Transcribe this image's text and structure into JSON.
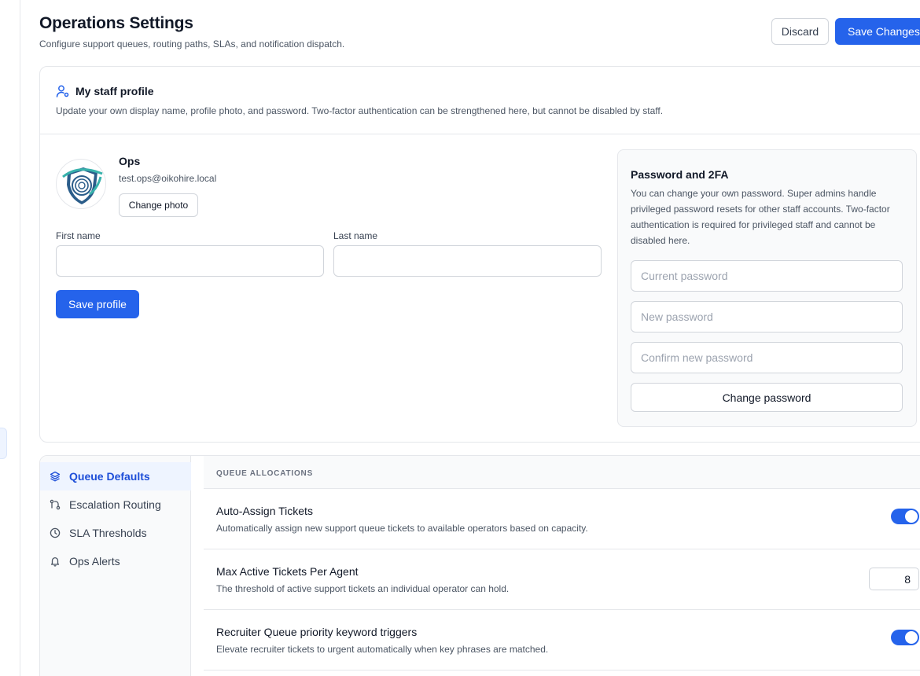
{
  "header": {
    "title": "Operations Settings",
    "subtitle": "Configure support queues, routing paths, SLAs, and notification dispatch.",
    "discard_label": "Discard",
    "save_label": "Save Changes"
  },
  "profile": {
    "title": "My staff profile",
    "description": "Update your own display name, profile photo, and password. Two-factor authentication can be strengthened here, but cannot be disabled by staff.",
    "name": "Ops",
    "email": "test.ops@oikohire.local",
    "change_photo_label": "Change photo",
    "first_name_label": "First name",
    "first_name_value": "",
    "last_name_label": "Last name",
    "last_name_value": "",
    "save_profile_label": "Save profile"
  },
  "password": {
    "title": "Password and 2FA",
    "description": "You can change your own password. Super admins handle privileged password resets for other staff accounts. Two-factor authentication is required for privileged staff and cannot be disabled here.",
    "current_placeholder": "Current password",
    "new_placeholder": "New password",
    "confirm_placeholder": "Confirm new password",
    "change_label": "Change password"
  },
  "nav": {
    "items": [
      {
        "label": "Queue Defaults",
        "icon": "layers-icon",
        "active": true
      },
      {
        "label": "Escalation Routing",
        "icon": "route-icon",
        "active": false
      },
      {
        "label": "SLA Thresholds",
        "icon": "clock-icon",
        "active": false
      },
      {
        "label": "Ops Alerts",
        "icon": "bell-icon",
        "active": false
      }
    ]
  },
  "section": {
    "label": "QUEUE ALLOCATIONS",
    "rows": [
      {
        "title": "Auto-Assign Tickets",
        "description": "Automatically assign new support queue tickets to available operators based on capacity.",
        "control": "toggle",
        "enabled": true
      },
      {
        "title": "Max Active Tickets Per Agent",
        "description": "The threshold of active support tickets an individual operator can hold.",
        "control": "number",
        "value": "8"
      },
      {
        "title": "Recruiter Queue priority keyword triggers",
        "description": "Elevate recruiter tickets to urgent automatically when key phrases are matched.",
        "control": "toggle",
        "enabled": true
      }
    ]
  },
  "colors": {
    "primary": "#2563eb",
    "nav_active_bg": "#eef4ff",
    "border": "#e5e7eb"
  }
}
